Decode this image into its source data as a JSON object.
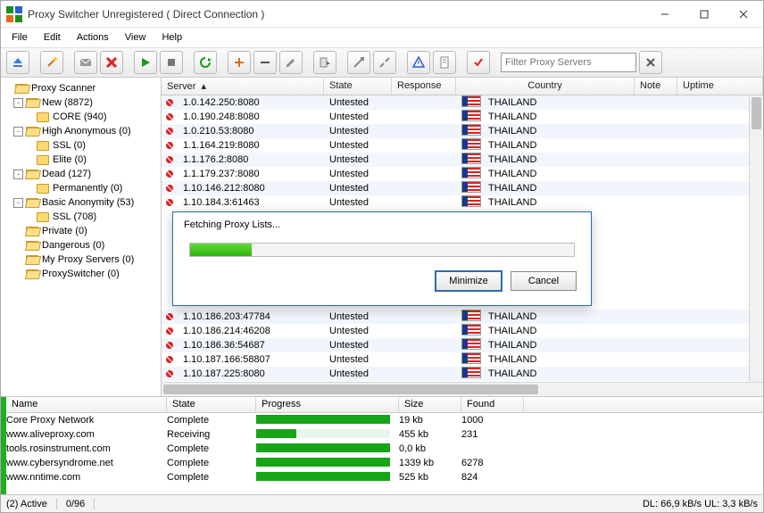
{
  "window": {
    "title": "Proxy Switcher Unregistered ( Direct Connection )"
  },
  "menu": [
    "File",
    "Edit",
    "Actions",
    "View",
    "Help"
  ],
  "toolbar": {
    "filter_placeholder": "Filter Proxy Servers"
  },
  "tree": {
    "root": "Proxy Scanner",
    "nodes": [
      {
        "exp": "-",
        "label": "New (8872)",
        "indent": 1,
        "children": [
          {
            "label": "CORE (940)",
            "indent": 2
          }
        ]
      },
      {
        "exp": "-",
        "label": "High Anonymous (0)",
        "indent": 1,
        "children": [
          {
            "label": "SSL (0)",
            "indent": 2
          },
          {
            "label": "Elite (0)",
            "indent": 2
          }
        ]
      },
      {
        "exp": "-",
        "label": "Dead (127)",
        "indent": 1,
        "children": [
          {
            "label": "Permanently (0)",
            "indent": 2
          }
        ]
      },
      {
        "exp": "-",
        "label": "Basic Anonymity (53)",
        "indent": 1,
        "children": [
          {
            "label": "SSL (708)",
            "indent": 2
          }
        ]
      },
      {
        "exp": "",
        "label": "Private (0)",
        "indent": 1
      },
      {
        "exp": "",
        "label": "Dangerous (0)",
        "indent": 1
      },
      {
        "exp": "",
        "label": "My Proxy Servers (0)",
        "indent": 1
      },
      {
        "exp": "",
        "label": "ProxySwitcher (0)",
        "indent": 1
      }
    ]
  },
  "columns": {
    "server": "Server",
    "state": "State",
    "response": "Response",
    "country": "Country",
    "note": "Note",
    "uptime": "Uptime"
  },
  "proxies": [
    {
      "server": "1.0.142.250:8080",
      "state": "Untested",
      "country": "THAILAND"
    },
    {
      "server": "1.0.190.248:8080",
      "state": "Untested",
      "country": "THAILAND"
    },
    {
      "server": "1.0.210.53:8080",
      "state": "Untested",
      "country": "THAILAND"
    },
    {
      "server": "1.1.164.219:8080",
      "state": "Untested",
      "country": "THAILAND"
    },
    {
      "server": "1.1.176.2:8080",
      "state": "Untested",
      "country": "THAILAND"
    },
    {
      "server": "1.1.179.237:8080",
      "state": "Untested",
      "country": "THAILAND"
    },
    {
      "server": "1.10.146.212:8080",
      "state": "Untested",
      "country": "THAILAND"
    },
    {
      "server": "1.10.184.3:61463",
      "state": "Untested",
      "country": "THAILAND"
    },
    {
      "server": "1.10.186.203:47784",
      "state": "Untested",
      "country": "THAILAND"
    },
    {
      "server": "1.10.186.214:46208",
      "state": "Untested",
      "country": "THAILAND"
    },
    {
      "server": "1.10.186.36:54687",
      "state": "Untested",
      "country": "THAILAND"
    },
    {
      "server": "1.10.187.166:58807",
      "state": "Untested",
      "country": "THAILAND"
    },
    {
      "server": "1.10.187.225:8080",
      "state": "Untested",
      "country": "THAILAND"
    }
  ],
  "dialog": {
    "message": "Fetching Proxy Lists...",
    "minimize": "Minimize",
    "cancel": "Cancel"
  },
  "downloads": {
    "cols": {
      "name": "Name",
      "state": "State",
      "progress": "Progress",
      "size": "Size",
      "found": "Found"
    },
    "rows": [
      {
        "name": "Core Proxy Network",
        "state": "Complete",
        "progress": 100,
        "size": "19 kb",
        "found": "1000"
      },
      {
        "name": "www.aliveproxy.com",
        "state": "Receiving",
        "progress": 30,
        "size": "455 kb",
        "found": "231"
      },
      {
        "name": "tools.rosinstrument.com",
        "state": "Complete",
        "progress": 100,
        "size": "0,0 kb",
        "found": ""
      },
      {
        "name": "www.cybersyndrome.net",
        "state": "Complete",
        "progress": 100,
        "size": "1339 kb",
        "found": "6278"
      },
      {
        "name": "www.nntime.com",
        "state": "Complete",
        "progress": 100,
        "size": "525 kb",
        "found": "824"
      }
    ]
  },
  "status": {
    "active": "(2) Active",
    "progress": "0/96",
    "dl": "DL: 66,9 kB/s UL: 3,3 kB/s"
  }
}
